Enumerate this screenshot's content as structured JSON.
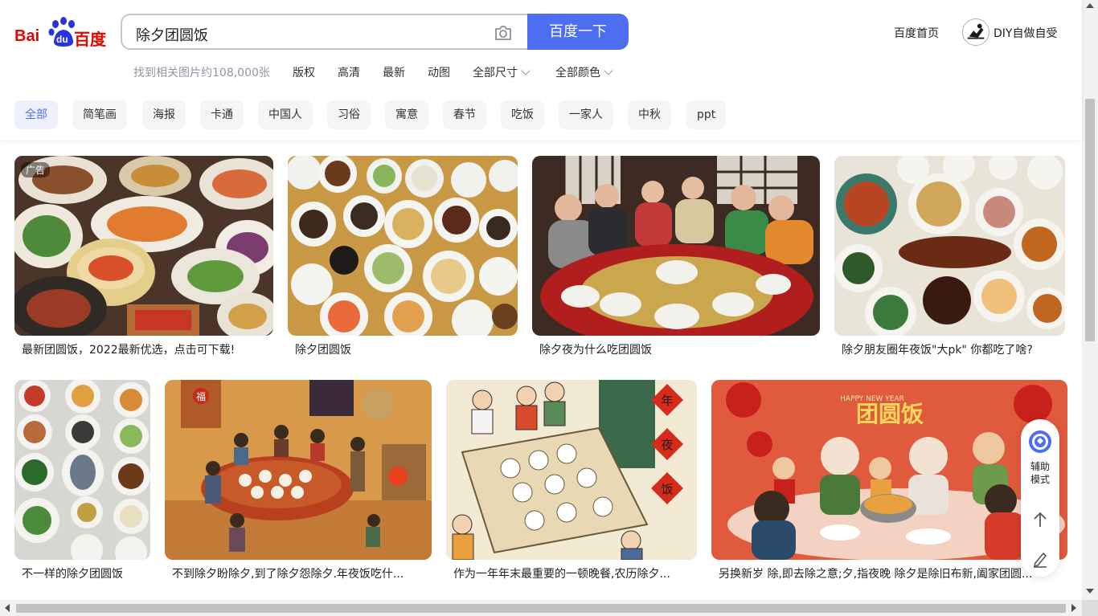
{
  "header": {
    "logo_bai": "Bai",
    "logo_du": "du",
    "logo_cn": "百度",
    "search_query": "除夕团圆饭",
    "search_button": "百度一下",
    "camera_icon": "camera-icon",
    "home_link": "百度首页",
    "diy_label": "DIY自做自受"
  },
  "filters": {
    "count": "找到相关图片约108,000张",
    "items": [
      "版权",
      "高清",
      "最新",
      "动图"
    ],
    "size": "全部尺寸",
    "color": "全部颜色"
  },
  "tags": [
    "全部",
    "简笔画",
    "海报",
    "卡通",
    "中国人",
    "习俗",
    "寓意",
    "春节",
    "吃饭",
    "一家人",
    "中秋",
    "ppt"
  ],
  "ad_badge": "广告",
  "results": [
    {
      "caption": "最新团圆饭，2022最新优选，点击可下载!",
      "ad": true
    },
    {
      "caption": "除夕团圆饭"
    },
    {
      "caption": "除夕夜为什么吃团圆饭"
    },
    {
      "caption": "除夕朋友圈年夜饭\"大pk\" 你都吃了啥?"
    },
    {
      "caption": "不一样的除夕团圆饭"
    },
    {
      "caption": "不到除夕盼除夕,到了除夕怨除夕.年夜饭吃什..."
    },
    {
      "caption": "作为一年年末最重要的一顿晚餐,农历除夕..."
    },
    {
      "caption": "另换新岁 除,即去除之意;夕,指夜晚 除夕是除旧布新,阖家团圆..."
    }
  ],
  "image_texts": {
    "poster_title": "团圆饭",
    "poster_banner": "HAPPY NEW YEAR",
    "couplet": [
      "年",
      "夜",
      "饭"
    ],
    "door_sign": "福"
  },
  "sidetool": {
    "assist_label_1": "辅助",
    "assist_label_2": "模式"
  },
  "colors": {
    "brand_blue": "#4e6ef2",
    "brand_red": "#e10602"
  }
}
